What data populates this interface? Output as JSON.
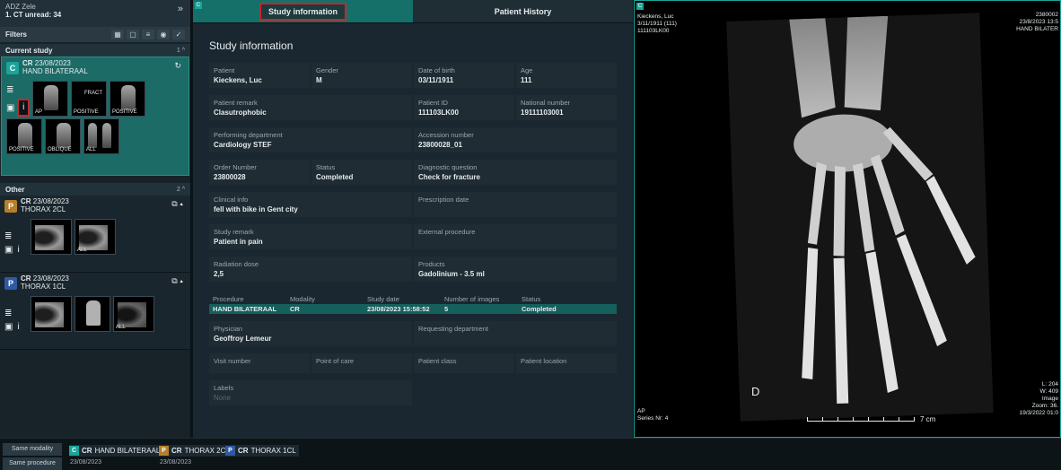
{
  "left_panel": {
    "header_line1": "ADZ Zele",
    "header_line2": "1. CT unread: 34",
    "filters_label": "Filters",
    "current_study_label": "Current study",
    "current_study_count": "1",
    "other_label": "Other",
    "other_count": "2",
    "studies": [
      {
        "badge": "C",
        "modality": "CR",
        "date": "23/08/2023",
        "name": "HAND BILATERAAL",
        "thumbs": [
          "AP",
          "FRACT",
          "POSITIVE",
          "POSITIVE",
          "POSITIVE",
          "OBLIQUE",
          "ALL"
        ]
      },
      {
        "badge": "P",
        "modality": "CR",
        "date": "23/08/2023",
        "name": "THORAX 2CL",
        "thumbs": [
          "",
          "ALL"
        ]
      },
      {
        "badge": "P",
        "modality": "CR",
        "date": "23/08/2023",
        "name": "THORAX 1CL",
        "thumbs": [
          "",
          "",
          "ALL"
        ]
      }
    ]
  },
  "center": {
    "tabs": [
      "Study information",
      "Patient History"
    ],
    "title": "Study information",
    "fields": {
      "patient": {
        "k": "Patient",
        "v": "Kieckens, Luc"
      },
      "gender": {
        "k": "Gender",
        "v": "M"
      },
      "dob": {
        "k": "Date of birth",
        "v": "03/11/1911"
      },
      "age": {
        "k": "Age",
        "v": "111"
      },
      "remark": {
        "k": "Patient remark",
        "v": "Clasutrophobic"
      },
      "pid": {
        "k": "Patient ID",
        "v": "111103LK00"
      },
      "national": {
        "k": "National number",
        "v": "19111103001"
      },
      "dept": {
        "k": "Performing department",
        "v": "Cardiology STEF"
      },
      "accession": {
        "k": "Accession number",
        "v": "23800028_01"
      },
      "order": {
        "k": "Order Number",
        "v": "23800028"
      },
      "status": {
        "k": "Status",
        "v": "Completed"
      },
      "diag": {
        "k": "Diagnostic question",
        "v": "Check for fracture"
      },
      "clinical": {
        "k": "Clinical info",
        "v": "fell with bike in Gent city"
      },
      "prescription": {
        "k": "Prescription date",
        "v": ""
      },
      "study_remark": {
        "k": "Study remark",
        "v": "Patient in pain"
      },
      "external": {
        "k": "External procedure",
        "v": ""
      },
      "dose": {
        "k": "Radiation dose",
        "v": "2,5"
      },
      "products": {
        "k": "Products",
        "v": "Gadolinium - 3.5 ml"
      },
      "physician": {
        "k": "Physician",
        "v": "Geoffroy Lemeur"
      },
      "requesting": {
        "k": "Requesting department",
        "v": ""
      },
      "visit": {
        "k": "Visit number",
        "v": ""
      },
      "point": {
        "k": "Point of care",
        "v": ""
      },
      "pclass": {
        "k": "Patient class",
        "v": ""
      },
      "plocation": {
        "k": "Patient location",
        "v": ""
      },
      "labels": {
        "k": "Labels",
        "v": "None"
      }
    },
    "procedure": {
      "headers": [
        "Procedure",
        "Modality",
        "Study date",
        "Number of images",
        "Status"
      ],
      "row": [
        "HAND BILATERAAL",
        "CR",
        "23/08/2023 15:58:52",
        "5",
        "Completed"
      ]
    }
  },
  "viewer": {
    "top_left": [
      "Kieckens, Luc",
      "3/11/1911 (111)",
      "111103LK00"
    ],
    "top_right": [
      "2380002",
      "23/8/2023 13:5",
      "HAND BILATER"
    ],
    "bottom_left": [
      "AP",
      "Series Nr: 4"
    ],
    "bottom_right": [
      "L: 204",
      "W: 409",
      "Image",
      "Zoom: 36.",
      "19/3/2022 01:0"
    ],
    "marker": "D",
    "scale_label": "7 cm"
  },
  "bottom_bar": {
    "btn_same_modality": "Same modality",
    "btn_same_procedure": "Same procedure",
    "tabs": [
      {
        "badge": "C",
        "modality": "CR",
        "name": "HAND BILATERAAL",
        "date": "23/08/2023"
      },
      {
        "badge": "P",
        "modality": "CR",
        "name": "THORAX 2CL",
        "date": "23/08/2023"
      },
      {
        "badge": "P",
        "modality": "CR",
        "name": "THORAX 1CL",
        "date": ""
      }
    ]
  },
  "colors": {
    "accent": "#1aa49a",
    "highlight": "#c7262e",
    "prior": "#b5802d",
    "prior_blue": "#2e5aa2"
  }
}
